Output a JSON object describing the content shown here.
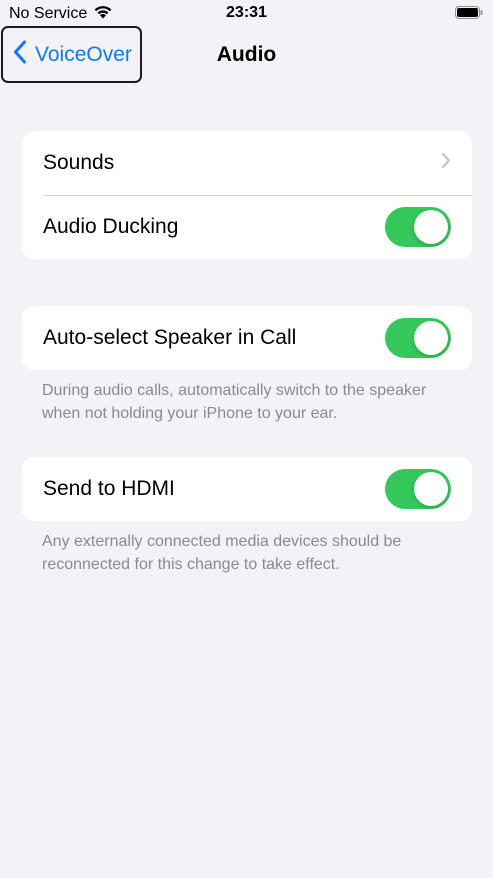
{
  "status_bar": {
    "carrier": "No Service",
    "time": "23:31",
    "icons": [
      "wifi-icon",
      "battery-icon"
    ]
  },
  "nav": {
    "back_label": "VoiceOver",
    "title": "Audio"
  },
  "groups": [
    {
      "rows": [
        {
          "label": "Sounds",
          "control": "chevron"
        },
        {
          "label": "Audio Ducking",
          "control": "toggle",
          "on": true
        }
      ]
    },
    {
      "rows": [
        {
          "label": "Auto-select Speaker in Call",
          "control": "toggle",
          "on": true
        }
      ],
      "footer": "During audio calls, automatically switch to the speaker when not holding your iPhone to your ear."
    },
    {
      "rows": [
        {
          "label": "Send to HDMI",
          "control": "toggle",
          "on": true
        }
      ],
      "footer": "Any externally connected media devices should be reconnected for this change to take effect."
    }
  ],
  "colors": {
    "background": "#f2f2f7",
    "accent": "#0a7aff",
    "toggle_on": "#34c759",
    "footer_text": "#8a8a8e"
  }
}
